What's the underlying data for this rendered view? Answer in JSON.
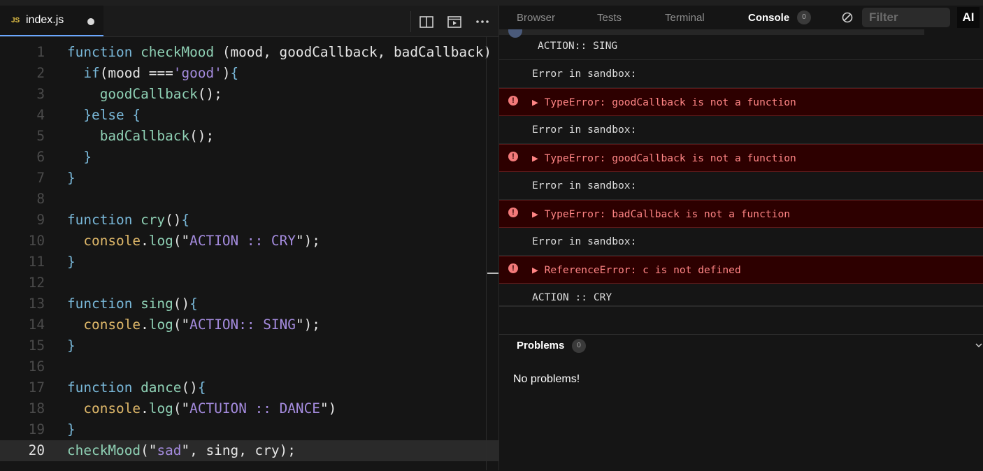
{
  "editor": {
    "tab": {
      "badge": "JS",
      "filename": "index.js"
    },
    "lines": [
      {
        "n": "1",
        "tokens": [
          [
            "k",
            "function "
          ],
          [
            "f",
            "checkMood"
          ],
          [
            "p",
            " (mood, goodCallback, badCallback)"
          ]
        ]
      },
      {
        "n": "2",
        "tokens": [
          [
            "p",
            "  "
          ],
          [
            "k",
            "if"
          ],
          [
            "p",
            "(mood ==="
          ],
          [
            "s",
            "'good'"
          ],
          [
            "p",
            ")"
          ],
          [
            "k",
            "{"
          ]
        ]
      },
      {
        "n": "3",
        "tokens": [
          [
            "p",
            "    "
          ],
          [
            "f",
            "goodCallback"
          ],
          [
            "p",
            "();"
          ]
        ]
      },
      {
        "n": "4",
        "tokens": [
          [
            "p",
            "  "
          ],
          [
            "k",
            "}else {"
          ]
        ]
      },
      {
        "n": "5",
        "tokens": [
          [
            "p",
            "    "
          ],
          [
            "f",
            "badCallback"
          ],
          [
            "p",
            "();"
          ]
        ]
      },
      {
        "n": "6",
        "tokens": [
          [
            "p",
            "  "
          ],
          [
            "k",
            "}"
          ]
        ]
      },
      {
        "n": "7",
        "tokens": [
          [
            "k",
            "}"
          ]
        ]
      },
      {
        "n": "8",
        "tokens": []
      },
      {
        "n": "9",
        "tokens": [
          [
            "k",
            "function "
          ],
          [
            "f",
            "cry"
          ],
          [
            "p",
            "()"
          ],
          [
            "k",
            "{"
          ]
        ]
      },
      {
        "n": "10",
        "tokens": [
          [
            "p",
            "  "
          ],
          [
            "o",
            "console"
          ],
          [
            "p",
            "."
          ],
          [
            "f",
            "log"
          ],
          [
            "p",
            "(\""
          ],
          [
            "s",
            "ACTION :: CRY"
          ],
          [
            "p",
            "\");"
          ]
        ]
      },
      {
        "n": "11",
        "tokens": [
          [
            "k",
            "}"
          ]
        ]
      },
      {
        "n": "12",
        "tokens": []
      },
      {
        "n": "13",
        "tokens": [
          [
            "k",
            "function "
          ],
          [
            "f",
            "sing"
          ],
          [
            "p",
            "()"
          ],
          [
            "k",
            "{"
          ]
        ]
      },
      {
        "n": "14",
        "tokens": [
          [
            "p",
            "  "
          ],
          [
            "o",
            "console"
          ],
          [
            "p",
            "."
          ],
          [
            "f",
            "log"
          ],
          [
            "p",
            "(\""
          ],
          [
            "s",
            "ACTION:: SING"
          ],
          [
            "p",
            "\");"
          ]
        ]
      },
      {
        "n": "15",
        "tokens": [
          [
            "k",
            "}"
          ]
        ]
      },
      {
        "n": "16",
        "tokens": []
      },
      {
        "n": "17",
        "tokens": [
          [
            "k",
            "function "
          ],
          [
            "f",
            "dance"
          ],
          [
            "p",
            "()"
          ],
          [
            "k",
            "{"
          ]
        ]
      },
      {
        "n": "18",
        "tokens": [
          [
            "p",
            "  "
          ],
          [
            "o",
            "console"
          ],
          [
            "p",
            "."
          ],
          [
            "f",
            "log"
          ],
          [
            "p",
            "(\""
          ],
          [
            "s",
            "ACTUION :: DANCE"
          ],
          [
            "p",
            "\")"
          ]
        ]
      },
      {
        "n": "19",
        "tokens": [
          [
            "k",
            "}"
          ]
        ]
      },
      {
        "n": "20",
        "tokens": [
          [
            "f",
            "checkMood"
          ],
          [
            "p",
            "(\""
          ],
          [
            "s",
            "sad"
          ],
          [
            "p",
            "\", sing, cry);"
          ]
        ]
      }
    ]
  },
  "panel": {
    "tabs": [
      {
        "label": "Browser",
        "active": false
      },
      {
        "label": "Tests",
        "active": false
      },
      {
        "label": "Terminal",
        "active": false
      },
      {
        "label": "Console",
        "active": true
      }
    ],
    "console_badge": "0",
    "filter_placeholder": "Filter",
    "ai_label": "AI",
    "console": {
      "partial_top": "ACTION:: SING",
      "entries": [
        {
          "type": "log",
          "text": "Error in sandbox:"
        },
        {
          "type": "error",
          "text": "TypeError: goodCallback is not a function"
        },
        {
          "type": "log",
          "text": "Error in sandbox:"
        },
        {
          "type": "error",
          "text": "TypeError: goodCallback is not a function"
        },
        {
          "type": "log",
          "text": "Error in sandbox:"
        },
        {
          "type": "error",
          "text": "TypeError: badCallback is not a function"
        },
        {
          "type": "log",
          "text": "Error in sandbox:"
        },
        {
          "type": "error",
          "text": "ReferenceError: c is not defined"
        },
        {
          "type": "log",
          "text": "ACTION :: CRY"
        }
      ],
      "prompt_symbol": "›"
    },
    "problems": {
      "title": "Problems",
      "count": "0",
      "empty_text": "No problems!"
    }
  }
}
